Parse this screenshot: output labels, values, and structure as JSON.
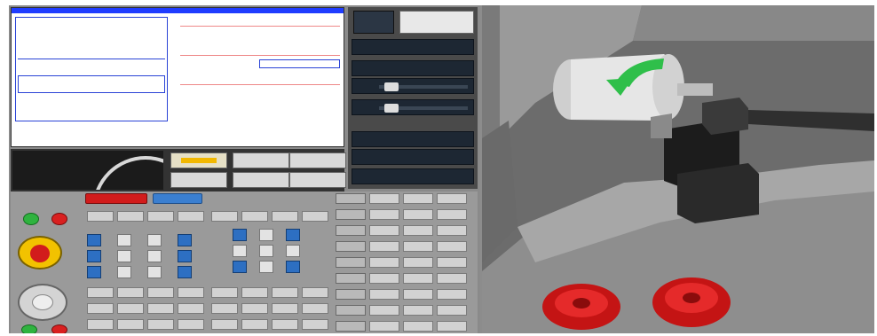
{
  "window": {
    "title": ""
  },
  "screen": {
    "title": "",
    "info_lines": [
      "",
      "",
      "",
      "",
      "",
      "",
      "",
      "",
      ""
    ],
    "status_text": "",
    "coords": {
      "header": "",
      "big_rows": [
        {
          "label": "",
          "value": ""
        },
        {
          "label": "",
          "value": ""
        }
      ]
    }
  },
  "panel": {
    "colors": {
      "accent_red": "#d21c1c",
      "accent_blue": "#3b7fd0",
      "green": "#2fb33f",
      "estop_yellow": "#f2c200"
    }
  },
  "viewport": {
    "icons": [
      "chuck-icon",
      "rotation-arrow-icon",
      "tool-holder-icon",
      "handwheel-icon"
    ],
    "colors": {
      "arrow": "#2fbf4a",
      "handwheel": "#d11a1a"
    }
  }
}
